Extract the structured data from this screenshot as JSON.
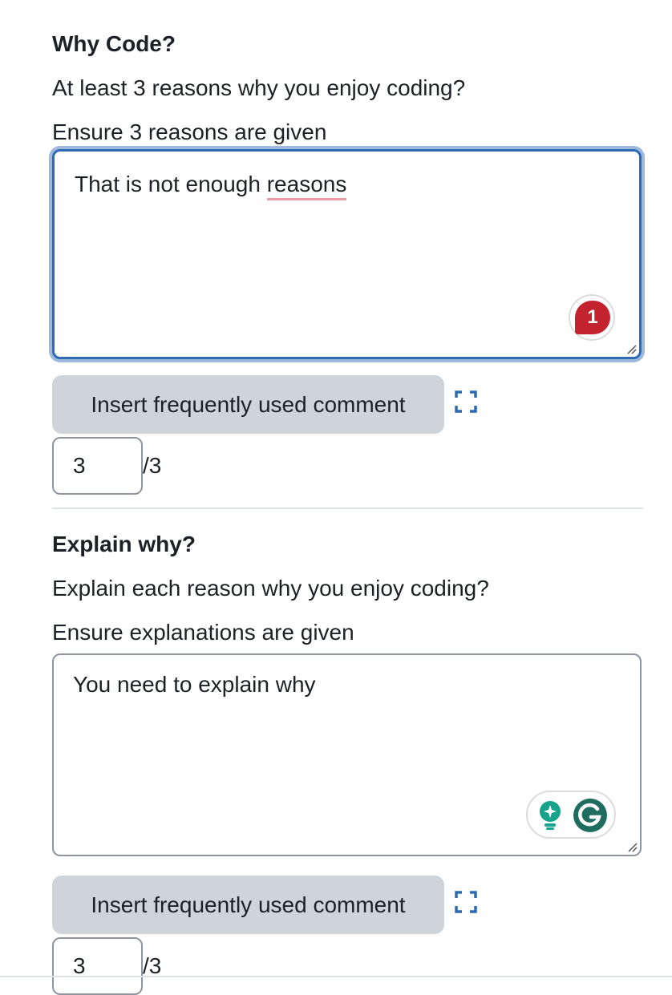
{
  "questions": [
    {
      "title": "Why Code?",
      "prompt": "At least 3 reasons why you enjoy coding?",
      "guidance": "Ensure 3 reasons are given",
      "comment_prefix": "That is not enough ",
      "comment_flagged_word": "reasons",
      "grammar_issue_count": "1",
      "insert_button_label": "Insert frequently used comment",
      "score_value": "3",
      "score_max": "/3"
    },
    {
      "title": "Explain why?",
      "prompt": "Explain each reason why you enjoy coding?",
      "guidance": "Ensure explanations are given",
      "comment": "You need to explain why",
      "insert_button_label": "Insert frequently used comment",
      "score_value": "3",
      "score_max": "/3"
    }
  ],
  "icons": {
    "expand": "expand-icon",
    "grammarly_badge": "grammarly-issue-badge",
    "grammarly_assist": "grammarly-lightbulb-icon",
    "grammarly_logo": "grammarly-logo-icon"
  },
  "colors": {
    "focus_border": "#2f6ab5",
    "button_bg": "#ced4da",
    "issue_badge": "#c3222f",
    "grammarly_green": "#15a38b",
    "link_blue": "#2f6ab5"
  }
}
